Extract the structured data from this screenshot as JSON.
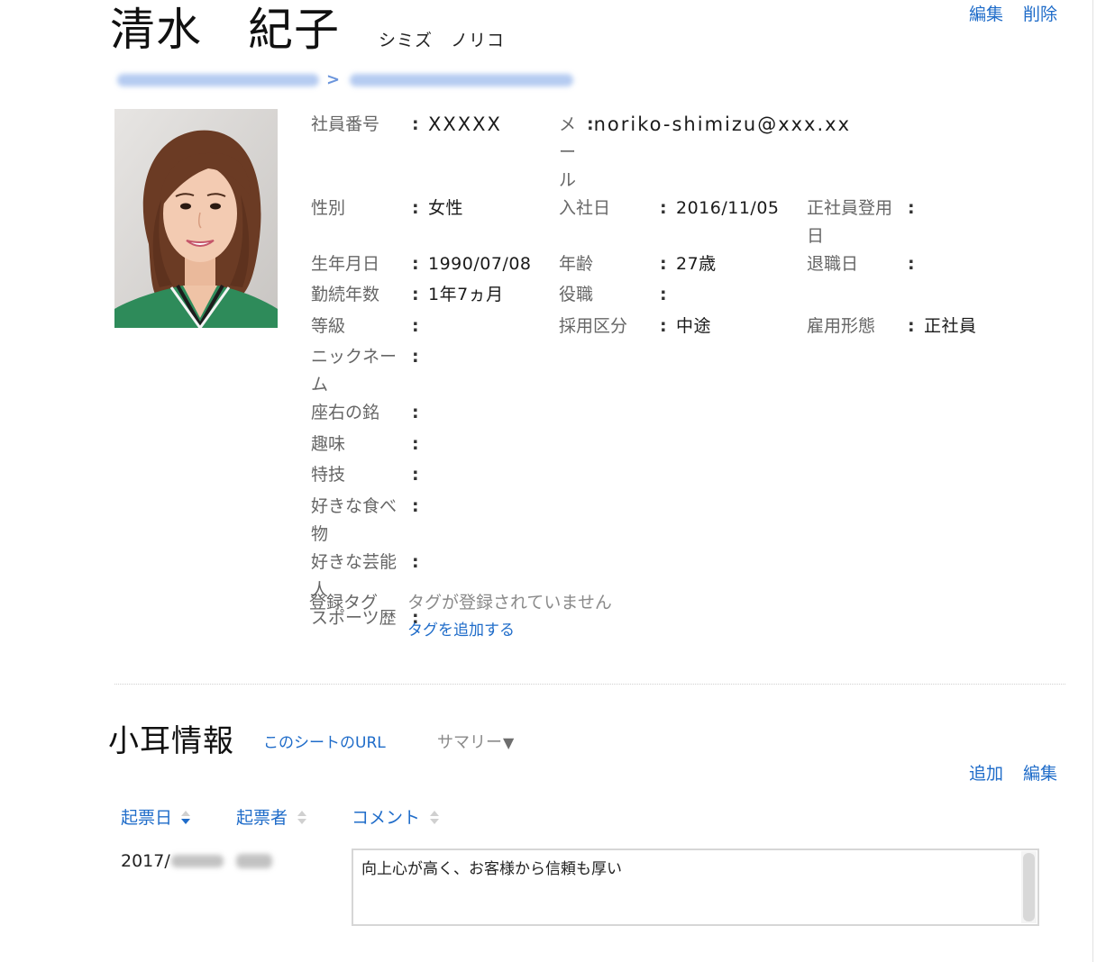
{
  "colors": {
    "link": "#1f6cc9",
    "label": "#666666",
    "text": "#1a1a1a",
    "muted": "#8a8a8a",
    "divider": "#d0d0d0"
  },
  "header": {
    "name": "清水　紀子",
    "kana": "シミズ　ノリコ",
    "edit_label": "編集",
    "delete_label": "削除",
    "breadcrumb_separator": ">"
  },
  "field_separator": ":",
  "fields": [
    [
      {
        "label": "社員番号",
        "value": "XXXXX"
      },
      {
        "label": "メール",
        "value": "noriko-shimizu@xxx.xx"
      }
    ],
    [
      {
        "label": "性別",
        "value": "女性"
      },
      {
        "label": "入社日",
        "value": "2016/11/05"
      },
      {
        "label": "正社員登用日",
        "value": ""
      }
    ],
    [
      {
        "label": "生年月日",
        "value": "1990/07/08"
      },
      {
        "label": "年齢",
        "value": "27歳"
      },
      {
        "label": "退職日",
        "value": ""
      }
    ],
    [
      {
        "label": "勤続年数",
        "value": "1年7ヵ月"
      },
      {
        "label": "役職",
        "value": ""
      }
    ],
    [
      {
        "label": "等級",
        "value": ""
      },
      {
        "label": "採用区分",
        "value": "中途"
      },
      {
        "label": "雇用形態",
        "value": "正社員"
      }
    ],
    [
      {
        "label": "ニックネーム",
        "value": ""
      }
    ],
    [
      {
        "label": "座右の銘",
        "value": ""
      }
    ],
    [
      {
        "label": "趣味",
        "value": ""
      }
    ],
    [
      {
        "label": "特技",
        "value": ""
      }
    ],
    [
      {
        "label": "好きな食べ物",
        "value": ""
      }
    ],
    [
      {
        "label": "好きな芸能人",
        "value": ""
      }
    ],
    [
      {
        "label": "スポーツ歴",
        "value": ""
      }
    ]
  ],
  "tags": {
    "label": "登録タグ",
    "empty_text": "タグが登録されていません",
    "add_link": "タグを追加する"
  },
  "komimi": {
    "title": "小耳情報",
    "sheet_url_link": "このシートのURL",
    "summary_label": "サマリー",
    "summary_caret": "▼",
    "add_label": "追加",
    "edit_label": "編集",
    "columns": [
      {
        "label": "起票日",
        "sort": "desc"
      },
      {
        "label": "起票者",
        "sort": "none"
      },
      {
        "label": "コメント",
        "sort": "none"
      }
    ],
    "rows": [
      {
        "date": "2017/",
        "comment": "向上心が高く、お客様から信頼も厚い"
      }
    ]
  }
}
